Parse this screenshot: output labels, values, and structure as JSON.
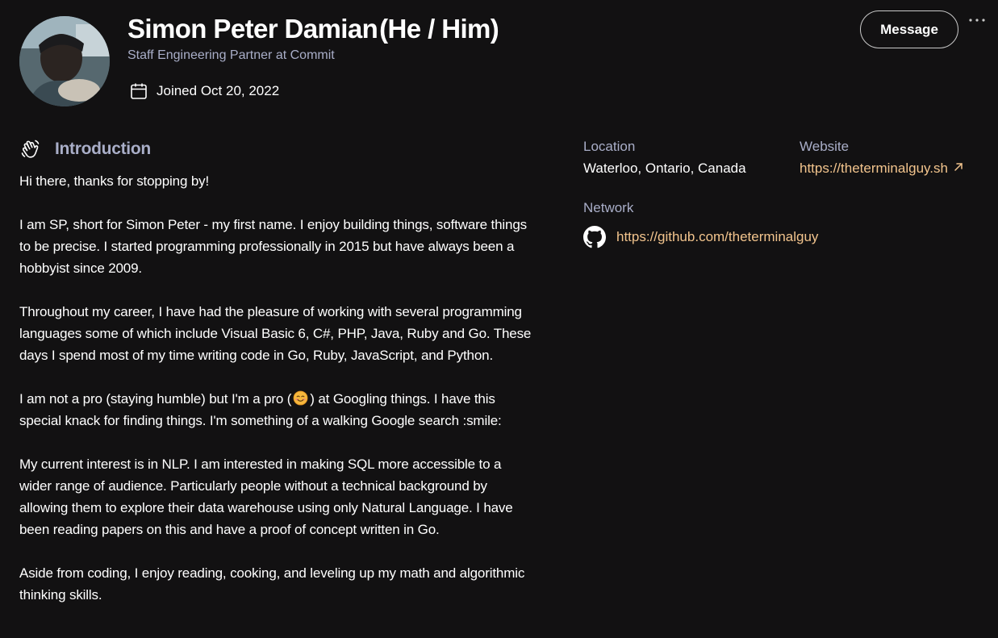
{
  "profile": {
    "name": "Simon Peter Damian",
    "pronouns": "(He / Him)",
    "headline": "Staff Engineering Partner at Commit",
    "joined": "Joined Oct 20, 2022"
  },
  "actions": {
    "message_label": "Message",
    "more_label": "⋯"
  },
  "intro": {
    "title": "Introduction",
    "paragraphs": [
      "Hi there, thanks for stopping by!",
      "I am SP, short for Simon Peter - my first name.  I enjoy building things, software things to be precise. I started programming professionally in 2015 but have always been a hobbyist since 2009.",
      "Throughout my career, I have had the pleasure of working with several programming languages some of which include Visual Basic 6, C#, PHP, Java, Ruby and Go. These days I spend most of my time writing code in Go, Ruby, JavaScript, and Python.",
      {
        "before": "I am not a pro (staying humble) but I'm a pro (",
        "after": ") at Googling things. I have this special knack for finding things. I'm something of a walking Google search :smile:"
      },
      "My current interest is in NLP. I am interested in making SQL more accessible to a wider range of audience. Particularly people without a technical background by allowing them to explore their data warehouse using only Natural Language. I have been reading papers on this and have a proof of concept written in Go.",
      "Aside from coding, I enjoy reading, cooking, and leveling up my math and algorithmic thinking skills."
    ]
  },
  "sidebar": {
    "location_label": "Location",
    "location_value": "Waterloo, Ontario, Canada",
    "website_label": "Website",
    "website_url": "https://theterminalguy.sh",
    "network_label": "Network",
    "network_url": "https://github.com/theterminalguy"
  },
  "colors": {
    "background": "#121112",
    "muted_text": "#a9aec8",
    "link": "#f2c48d",
    "text": "#ffffff"
  },
  "icons": {
    "avatar": "profile-photo",
    "joined": "calendar-icon",
    "intro": "waving-hand-icon",
    "emoji": "smiling-face-emoji",
    "website": "external-link-arrow-icon",
    "network": "github-icon",
    "more": "more-options-icon"
  }
}
